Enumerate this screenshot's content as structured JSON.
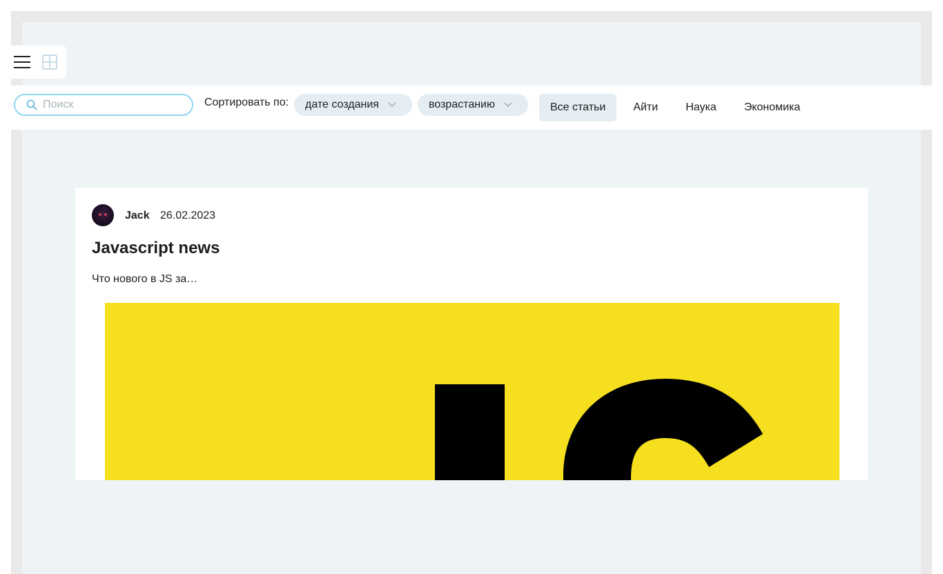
{
  "view_switcher": {
    "list_icon": "hamburger-list-icon",
    "tile_icon": "grid-tile-icon"
  },
  "toolbar": {
    "search": {
      "placeholder": "Поиск",
      "value": ""
    },
    "sort_label": "Сортировать по:",
    "sort_field": {
      "selected": "дате создания"
    },
    "sort_order": {
      "selected": "возрастанию"
    },
    "tabs": [
      {
        "label": "Все статьи",
        "active": true
      },
      {
        "label": "Айти",
        "active": false
      },
      {
        "label": "Наука",
        "active": false
      },
      {
        "label": "Экономика",
        "active": false
      }
    ]
  },
  "article": {
    "author": "Jack",
    "date": "26.02.2023",
    "title": "Javascript news",
    "excerpt": "Что нового в JS за…",
    "cover_logo_text": "JS"
  },
  "colors": {
    "accent_border": "#8fd7ef",
    "select_bg": "#e4edf2",
    "page_bg": "#eef3f6",
    "js_yellow": "#f5df1e"
  }
}
